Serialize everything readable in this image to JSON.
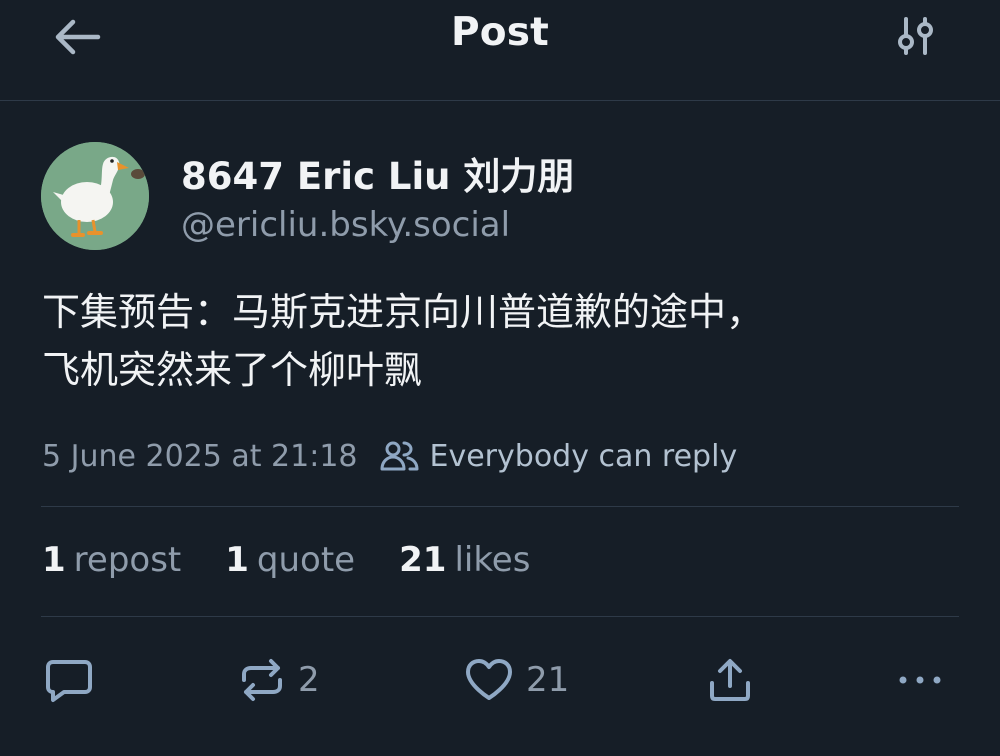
{
  "header": {
    "title": "Post",
    "back_icon": "arrow-left-icon",
    "settings_icon": "sliders-icon"
  },
  "author": {
    "display_name": "8647 Eric Liu 刘力朋",
    "handle": "@ericliu.bsky.social",
    "avatar_icon": "goose-avatar"
  },
  "post": {
    "text_lines": [
      "下集预告：马斯克进京向川普道歉的途中，",
      "飞机突然来了个柳叶飘"
    ],
    "timestamp": "5 June 2025 at 21:18",
    "reply_setting": "Everybody can reply",
    "reply_setting_icon": "people-icon"
  },
  "stats": {
    "reposts": {
      "count": "1",
      "label": "repost"
    },
    "quotes": {
      "count": "1",
      "label": "quote"
    },
    "likes": {
      "count": "21",
      "label": "likes"
    }
  },
  "actions": {
    "reply_icon": "comment-icon",
    "repost_icon": "repost-icon",
    "repost_count": "2",
    "like_icon": "heart-icon",
    "like_count": "21",
    "share_icon": "share-icon",
    "more_icon": "ellipsis-icon"
  },
  "colors": {
    "background": "#161e27",
    "text_primary": "#f1f3f5",
    "text_secondary": "#8f9cab",
    "accent": "#b3c2d1",
    "divider": "#2e3a48"
  }
}
